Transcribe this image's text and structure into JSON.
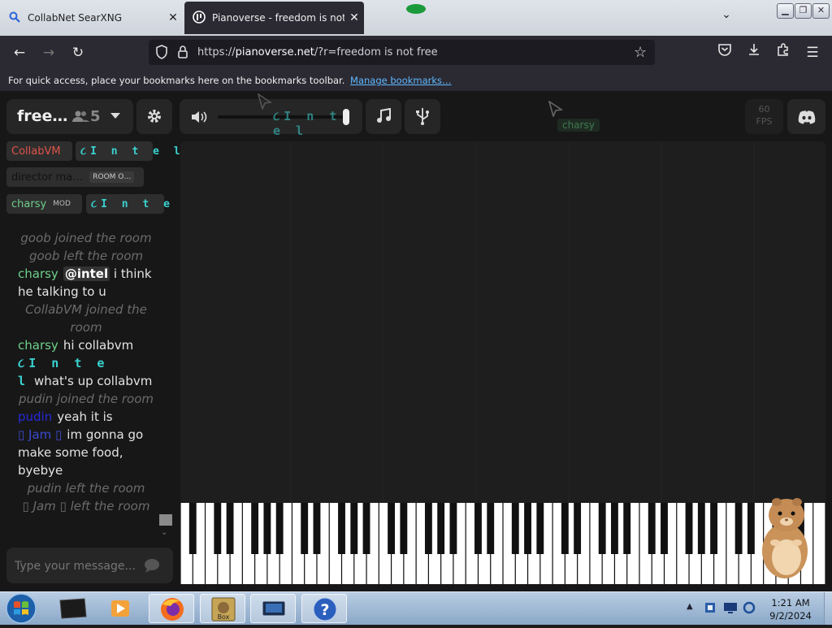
{
  "browser": {
    "tabs": [
      {
        "title": "CollabNet SearXNG",
        "icon": "search-icon",
        "active": false
      },
      {
        "title": "Pianoverse - freedom is not free",
        "icon": "pianoverse-favicon",
        "active": true
      }
    ],
    "url_scheme": "https://",
    "url_host": "pianoverse.net",
    "url_rest": "/?r=freedom is not free",
    "bookmarks_bar_text": "For quick access, place your bookmarks here on the bookmarks toolbar.",
    "bookmarks_bar_link": "Manage bookmarks…"
  },
  "room": {
    "name": "free…",
    "user_count": "5",
    "users": [
      {
        "name": "CollabVM",
        "color": "#e0534a",
        "badge": ""
      },
      {
        "name": "૮I n t e l",
        "color": "#3ad1d0",
        "badge": ""
      },
      {
        "name": "director ma…",
        "color": "#111111",
        "badge": "ROOM O…"
      },
      {
        "name": "charsy",
        "color": "#6fd08c",
        "badge": "MOD"
      },
      {
        "name": "૮I n t e l",
        "color": "#3ad1d0",
        "badge": ""
      }
    ]
  },
  "toolbar": {
    "volume_name_overlay": "૮I n t e l",
    "cursor_label": "charsy",
    "fps_value": "60",
    "fps_label": "FPS"
  },
  "chat": {
    "messages": [
      {
        "type": "system",
        "text": "goob joined the room"
      },
      {
        "type": "system",
        "text": "goob left the room"
      },
      {
        "type": "user",
        "name": "charsy",
        "color": "#6fd08c",
        "mention": "@intel",
        "text": "i think he talking to u"
      },
      {
        "type": "system",
        "text": "CollabVM joined the room"
      },
      {
        "type": "user",
        "name": "charsy",
        "color": "#6fd08c",
        "mention": "",
        "text": "hi collabvm"
      },
      {
        "type": "user",
        "name": "૮I n t e l",
        "color": "#3ad1d0",
        "mention": "",
        "text": "what's up collabvm"
      },
      {
        "type": "system",
        "text": "pudin joined the room"
      },
      {
        "type": "user",
        "name": "pudin",
        "color": "#2828d8",
        "mention": "",
        "text": "yeah it is"
      },
      {
        "type": "user",
        "name": "▯ Jam ▯",
        "color": "#3a4ad0",
        "mention": "",
        "text": "im gonna go make some food, byebye"
      },
      {
        "type": "system",
        "text": "pudin left the room"
      },
      {
        "type": "system",
        "text": "▯ Jam ▯ left the room"
      }
    ],
    "input_placeholder": "Type your message..."
  },
  "taskbar": {
    "time": "1:21 AM",
    "date": "9/2/2024",
    "items": [
      "start-orb",
      "vm-app-icon",
      "media-player-icon",
      "firefox-icon",
      "box-app-icon",
      "remote-desktop-icon",
      "help-icon"
    ]
  }
}
